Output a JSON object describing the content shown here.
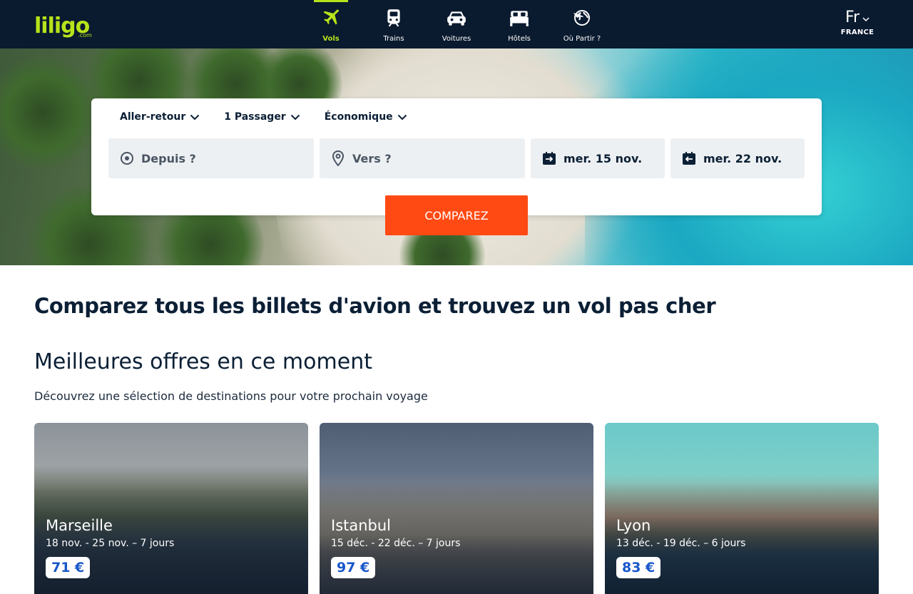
{
  "brand": {
    "logo_text": "liligo",
    "logo_sub": ".com",
    "accent": "#b7e31a",
    "cta_color": "#ff4a14",
    "header_bg": "#0a1a2f",
    "price_color": "#1857c9"
  },
  "nav": {
    "items": [
      {
        "label": "Vols",
        "icon": "plane-icon",
        "active": true
      },
      {
        "label": "Trains",
        "icon": "train-icon",
        "active": false
      },
      {
        "label": "Voitures",
        "icon": "car-icon",
        "active": false
      },
      {
        "label": "Hôtels",
        "icon": "bed-icon",
        "active": false
      },
      {
        "label": "Où Partir ?",
        "icon": "globe-plane-icon",
        "active": false
      }
    ]
  },
  "lang": {
    "code": "Fr",
    "country": "FRANCE"
  },
  "search": {
    "trip_type": "Aller-retour",
    "passengers": "1 Passager",
    "cabin": "Économique",
    "from_placeholder": "Depuis ?",
    "to_placeholder": "Vers ?",
    "depart_date": "mer. 15 nov.",
    "return_date": "mer. 22 nov.",
    "submit_label": "COMPAREZ"
  },
  "main": {
    "headline": "Comparez tous les billets d'avion et trouvez un vol pas cher",
    "offers_title": "Meilleures offres en ce moment",
    "offers_subtitle": "Découvrez une sélection de destinations pour votre prochain voyage",
    "offers": [
      {
        "city": "Marseille",
        "dates": "18 nov. - 25 nov.  – 7 jours",
        "price": "71 €"
      },
      {
        "city": "Istanbul",
        "dates": "15 déc. - 22 déc.  – 7 jours",
        "price": "97 €"
      },
      {
        "city": "Lyon",
        "dates": "13 déc. - 19 déc.  – 6 jours",
        "price": "83 €"
      }
    ]
  }
}
